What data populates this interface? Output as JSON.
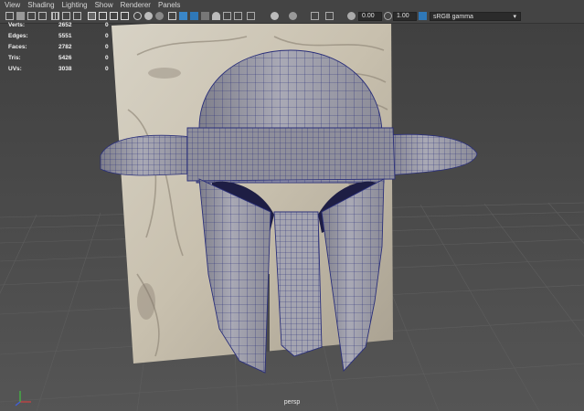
{
  "menu": [
    "View",
    "Shading",
    "Lighting",
    "Show",
    "Renderer",
    "Panels"
  ],
  "toolbar": {
    "exposure_value": "0.00",
    "gamma_value": "1.00",
    "color_space": "sRGB gamma",
    "icons": [
      "camera-select-icon",
      "camera-attributes-icon",
      "bookmark-icon",
      "image-plane-icon",
      "grid-icon",
      "film-gate-icon",
      "resolution-gate-icon",
      "gate-mask-icon",
      "field-chart-icon",
      "safe-action-icon",
      "safe-title-icon",
      "wireframe-icon",
      "smooth-shade-icon",
      "default-material-icon",
      "wireframe-on-shaded-icon",
      "xray-icon",
      "use-lights-icon",
      "textured-icon",
      "shadows-icon",
      "screen-space-ao-icon",
      "motion-blur-icon",
      "multisample-aa-icon",
      "depth-of-field-icon",
      "isolate-select-icon",
      "xray-joints-icon",
      "xray-active-icon",
      "exposure-icon",
      "gamma-icon",
      "view-transform-icon"
    ]
  },
  "hud": {
    "rows": [
      {
        "label": "Verts:",
        "value": "2652",
        "sel": "0"
      },
      {
        "label": "Edges:",
        "value": "5551",
        "sel": "0"
      },
      {
        "label": "Faces:",
        "value": "2782",
        "sel": "0"
      },
      {
        "label": "Tris:",
        "value": "5426",
        "sel": "0"
      },
      {
        "label": "UVs:",
        "value": "3038",
        "sel": "0"
      }
    ]
  },
  "camera_label": "persp",
  "colors": {
    "background": "#4b4b4b",
    "grid": "#5a5a5a",
    "helmet_fill": "#9a9aa6",
    "wireframe": "#2a2f7a",
    "menu_text": "#d6d6d6"
  }
}
